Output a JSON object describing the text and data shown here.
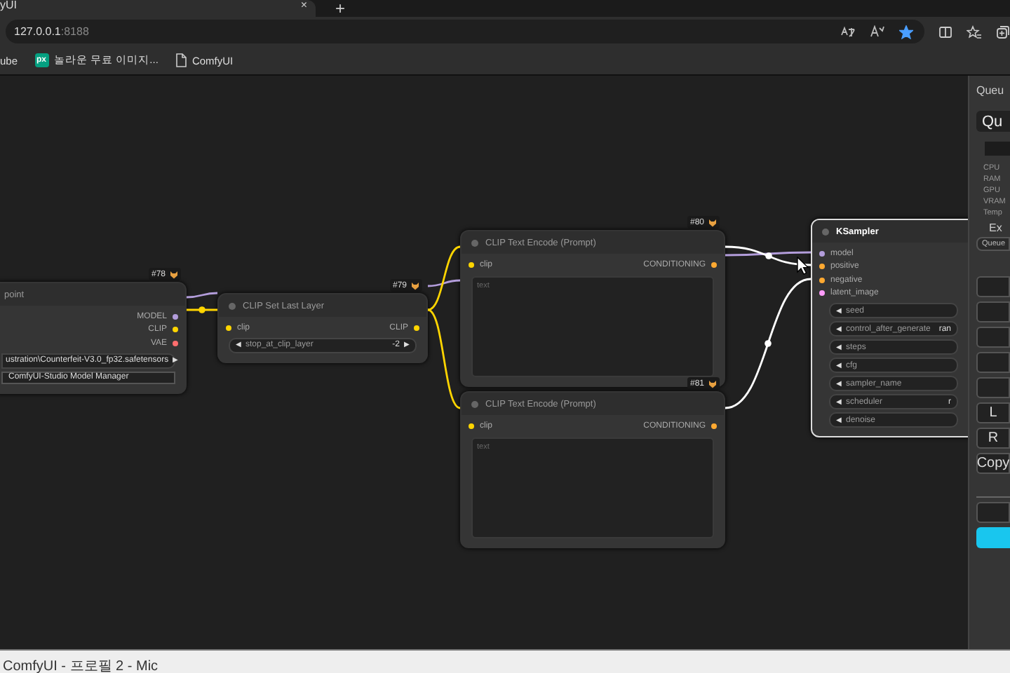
{
  "browser": {
    "tab": {
      "title": "yUI",
      "close": "×"
    },
    "new_tab": "+",
    "address": {
      "host": "127.0.0.1",
      "port": ":8188"
    },
    "favorited": true,
    "bookmarks": [
      {
        "kind": "plain",
        "label": "ube"
      },
      {
        "kind": "badge",
        "badge": "px",
        "label": "놀라운 무료 이미지..."
      },
      {
        "kind": "page",
        "label": "ComfyUI"
      }
    ]
  },
  "nodes": [
    {
      "id": "#78",
      "title": "point",
      "selected": false,
      "outputs": [
        {
          "name": "MODEL",
          "color": "#b39ddb"
        },
        {
          "name": "CLIP",
          "color": "#ffd500"
        },
        {
          "name": "VAE",
          "color": "#ff6e6e"
        }
      ],
      "widgets": [
        {
          "kind": "combo",
          "value": "ustration\\Counterfeit-V3.0_fp32.safetensors",
          "right": "▶"
        },
        {
          "kind": "button",
          "label": "ComfyUI-Studio Model Manager"
        }
      ]
    },
    {
      "id": "#79",
      "title": "CLIP Set Last Layer",
      "selected": false,
      "inputs": [
        {
          "name": "clip",
          "color": "#ffd500"
        }
      ],
      "outputs": [
        {
          "name": "CLIP",
          "color": "#ffd500"
        }
      ],
      "widgets": [
        {
          "kind": "combo",
          "left": "◀",
          "label": "stop_at_clip_layer",
          "value": "-2",
          "right": "▶"
        }
      ]
    },
    {
      "id": "#80",
      "title": "CLIP Text Encode (Prompt)",
      "selected": false,
      "inputs": [
        {
          "name": "clip",
          "color": "#ffd500"
        }
      ],
      "outputs": [
        {
          "name": "CONDITIONING",
          "color": "#ffa931"
        }
      ],
      "widgets": [
        {
          "kind": "textarea",
          "placeholder": "text"
        }
      ]
    },
    {
      "id": "#81",
      "title": "CLIP Text Encode (Prompt)",
      "selected": false,
      "inputs": [
        {
          "name": "clip",
          "color": "#ffd500"
        }
      ],
      "outputs": [
        {
          "name": "CONDITIONING",
          "color": "#ffa931"
        }
      ],
      "widgets": [
        {
          "kind": "textarea",
          "placeholder": "text"
        }
      ]
    },
    {
      "title": "KSampler",
      "selected": true,
      "inputs": [
        {
          "name": "model",
          "color": "#b39ddb"
        },
        {
          "name": "positive",
          "color": "#ffa931"
        },
        {
          "name": "negative",
          "color": "#ffa931"
        },
        {
          "name": "latent_image",
          "color": "#ff9cf9"
        }
      ],
      "widgets": [
        {
          "kind": "combo",
          "left": "◀",
          "label": "seed"
        },
        {
          "kind": "combo",
          "left": "◀",
          "label": "control_after_generate",
          "value": "ran"
        },
        {
          "kind": "combo",
          "left": "◀",
          "label": "steps"
        },
        {
          "kind": "combo",
          "left": "◀",
          "label": "cfg"
        },
        {
          "kind": "combo",
          "left": "◀",
          "label": "sampler_name"
        },
        {
          "kind": "combo",
          "left": "◀",
          "label": "scheduler",
          "value": "r"
        },
        {
          "kind": "combo",
          "left": "◀",
          "label": "denoise"
        }
      ]
    }
  ],
  "side_panel": {
    "heading": "Queu",
    "queue_button": "Qu",
    "stats": [
      "CPU",
      "RAM",
      "GPU",
      "VRAM",
      "Temp"
    ],
    "extra": "Ex",
    "queue_chip": "Queue",
    "buttons": [
      "L",
      "R",
      "Copy"
    ]
  },
  "taskbar": {
    "title": "ComfyUI - 프로필 2 - Mic"
  }
}
